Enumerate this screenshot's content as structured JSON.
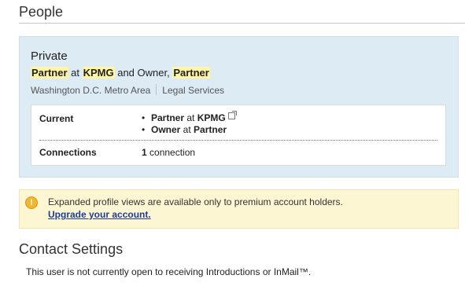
{
  "people_section": {
    "title": "People",
    "profile": {
      "name": "Private",
      "headline": {
        "title1": "Partner",
        "at": " at ",
        "company1": "KPMG",
        "and": " and Owner, ",
        "title2": "Partner"
      },
      "location": "Washington D.C. Metro Area",
      "industry": "Legal Services",
      "current_label": "Current",
      "positions": [
        {
          "bullet": "•",
          "title": "Partner",
          "at": " at ",
          "company": "KPMG",
          "icon": "external-link-icon"
        },
        {
          "bullet": "•",
          "title": "Owner",
          "at": " at ",
          "company": "Partner"
        }
      ],
      "connections_label": "Connections",
      "connections_count": "1",
      "connections_unit": " connection"
    }
  },
  "notice": {
    "icon": "warning-icon",
    "icon_glyph": "!",
    "message": "Expanded profile views are available only to premium account holders.",
    "link": "Upgrade your account."
  },
  "contact_section": {
    "title": "Contact Settings",
    "message": "This user is not currently open to receiving Introductions or InMail™."
  },
  "colors": {
    "card_bg": "#dcebf4",
    "highlight": "#fff3a6",
    "notice_bg": "#fdf6d3",
    "link": "#1b3d99",
    "warning": "#f2b632"
  }
}
